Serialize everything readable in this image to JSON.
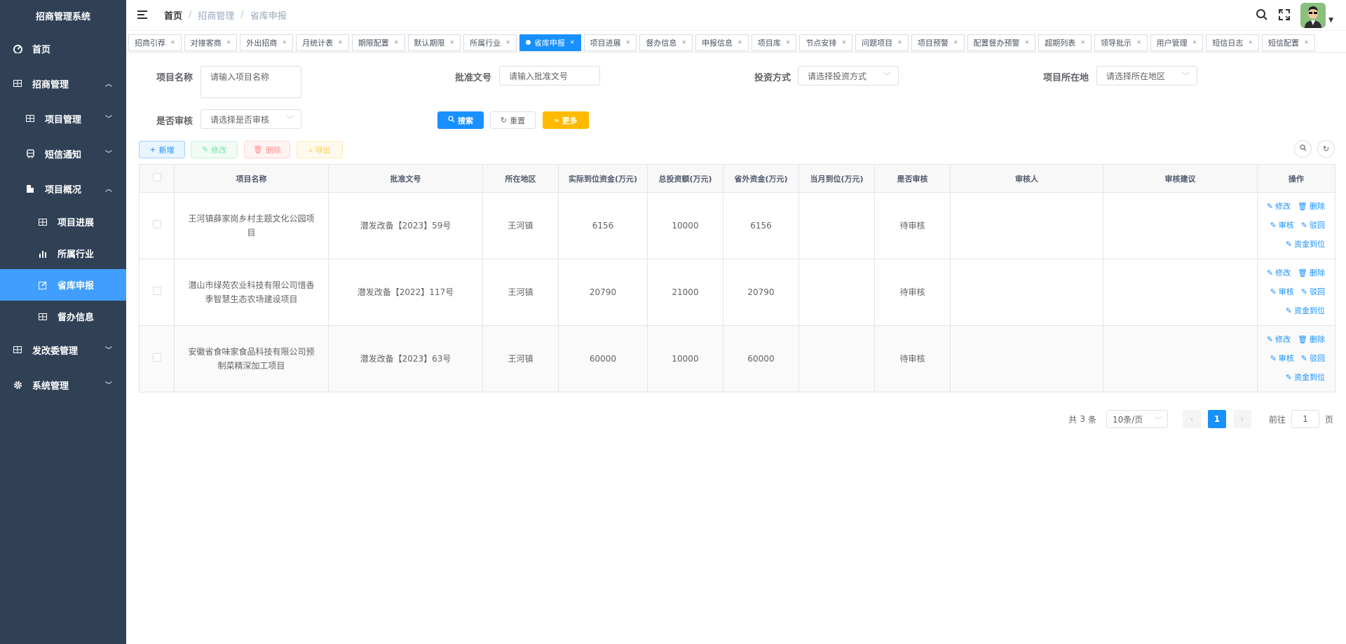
{
  "app": {
    "title": "招商管理系统"
  },
  "sidebar": {
    "items": [
      {
        "label": "首页",
        "icon": "dashboard-icon"
      },
      {
        "label": "招商管理",
        "icon": "grid-icon"
      },
      {
        "label": "项目管理",
        "icon": "grid-icon"
      },
      {
        "label": "短信通知",
        "icon": "bus-icon"
      },
      {
        "label": "项目概况",
        "icon": "document-icon"
      },
      {
        "label": "项目进展",
        "icon": "grid-icon"
      },
      {
        "label": "所属行业",
        "icon": "bar-chart-icon"
      },
      {
        "label": "省库申报",
        "icon": "edit-icon",
        "active": true
      },
      {
        "label": "督办信息",
        "icon": "grid-icon"
      },
      {
        "label": "发改委管理",
        "icon": "grid-icon"
      },
      {
        "label": "系统管理",
        "icon": "gear-icon"
      }
    ]
  },
  "breadcrumb": [
    "首页",
    "招商管理",
    "省库申报"
  ],
  "tabs": [
    {
      "label": "招商引荐"
    },
    {
      "label": "对接客商"
    },
    {
      "label": "外出招商"
    },
    {
      "label": "月统计表"
    },
    {
      "label": "期限配置"
    },
    {
      "label": "默认期限"
    },
    {
      "label": "所属行业"
    },
    {
      "label": "省库申报",
      "active": true
    },
    {
      "label": "项目进展"
    },
    {
      "label": "督办信息"
    },
    {
      "label": "申报信息"
    },
    {
      "label": "项目库"
    },
    {
      "label": "节点安排"
    },
    {
      "label": "问题项目"
    },
    {
      "label": "项目预警"
    },
    {
      "label": "配置督办预警"
    },
    {
      "label": "超期列表"
    },
    {
      "label": "领导批示"
    },
    {
      "label": "用户管理"
    },
    {
      "label": "短信日志"
    },
    {
      "label": "短信配置"
    }
  ],
  "filters": {
    "project_name": {
      "label": "项目名称",
      "placeholder": "请输入项目名称"
    },
    "approval_no": {
      "label": "批准文号",
      "placeholder": "请输入批准文号"
    },
    "invest_mode": {
      "label": "投资方式",
      "placeholder": "请选择投资方式"
    },
    "location": {
      "label": "项目所在地",
      "placeholder": "请选择所在地区"
    },
    "reviewed": {
      "label": "是否审核",
      "placeholder": "请选择是否审核"
    }
  },
  "search_buttons": {
    "search": "搜索",
    "reset": "重置",
    "more": "更多"
  },
  "toolbar": {
    "add": "新增",
    "edit": "修改",
    "delete": "删除",
    "export": "导出"
  },
  "table": {
    "headers": [
      "项目名称",
      "批准文号",
      "所在地区",
      "实际到位资金(万元)",
      "总投资额(万元)",
      "省外资金(万元)",
      "当月到位(万元)",
      "是否审核",
      "审核人",
      "审核建议",
      "操作"
    ],
    "rows": [
      {
        "name": "王河镇薛家岗乡村主题文化公园项目",
        "approval": "潜发改备【2023】59号",
        "region": "王河镇",
        "actual": "6156",
        "total": "10000",
        "outside": "6156",
        "month": "",
        "status": "待审核",
        "reviewer": "",
        "advice": ""
      },
      {
        "name": "潜山市绿苑农业科技有限公司惜香季智慧生态农场建设项目",
        "approval": "潜发改备【2022】117号",
        "region": "王河镇",
        "actual": "20790",
        "total": "21000",
        "outside": "20790",
        "month": "",
        "status": "待审核",
        "reviewer": "",
        "advice": ""
      },
      {
        "name": "安徽省食味家食品科技有限公司预制菜精深加工项目",
        "approval": "潜发改备【2023】63号",
        "region": "王河镇",
        "actual": "60000",
        "total": "10000",
        "outside": "60000",
        "month": "",
        "status": "待审核",
        "reviewer": "",
        "advice": ""
      }
    ],
    "ops": {
      "edit": "修改",
      "delete": "删除",
      "review": "审核",
      "reject": "驳回",
      "funds": "资金到位"
    }
  },
  "pagination": {
    "total_prefix": "共",
    "total": "3",
    "total_suffix": "条",
    "page_size": "10条/页",
    "current": "1",
    "goto_prefix": "前往",
    "goto_value": "1",
    "goto_suffix": "页"
  },
  "colors": {
    "sidebar": "#304156",
    "primary": "#1890ff",
    "success": "#13ce66",
    "warning": "#ffba00",
    "danger": "#ff4949"
  }
}
